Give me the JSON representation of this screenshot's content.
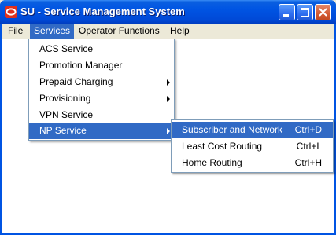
{
  "window": {
    "title": "SU - Service Management System",
    "icon": "oracle-logo-icon",
    "buttons": [
      "minimize-icon",
      "maximize-icon",
      "close-icon"
    ],
    "colors": {
      "titlebar": "#0054e3",
      "menu_highlight": "#316ac5",
      "watermark": "#e53c2a"
    }
  },
  "menubar": {
    "items": [
      {
        "label": "File"
      },
      {
        "label": "Services",
        "active": true
      },
      {
        "label": "Operator Functions"
      },
      {
        "label": "Help"
      }
    ]
  },
  "services_menu": {
    "items": [
      {
        "label": "ACS Service",
        "submenu": false
      },
      {
        "label": "Promotion Manager",
        "submenu": false
      },
      {
        "label": "Prepaid Charging",
        "submenu": true
      },
      {
        "label": "Provisioning",
        "submenu": true
      },
      {
        "label": "VPN Service",
        "submenu": false
      },
      {
        "label": "NP Service",
        "submenu": true,
        "highlighted": true
      }
    ]
  },
  "np_service_submenu": {
    "items": [
      {
        "label": "Subscriber and Network",
        "shortcut": "Ctrl+D",
        "highlighted": true
      },
      {
        "label": "Least Cost Routing",
        "shortcut": "Ctrl+L"
      },
      {
        "label": "Home Routing",
        "shortcut": "Ctrl+H"
      }
    ]
  }
}
